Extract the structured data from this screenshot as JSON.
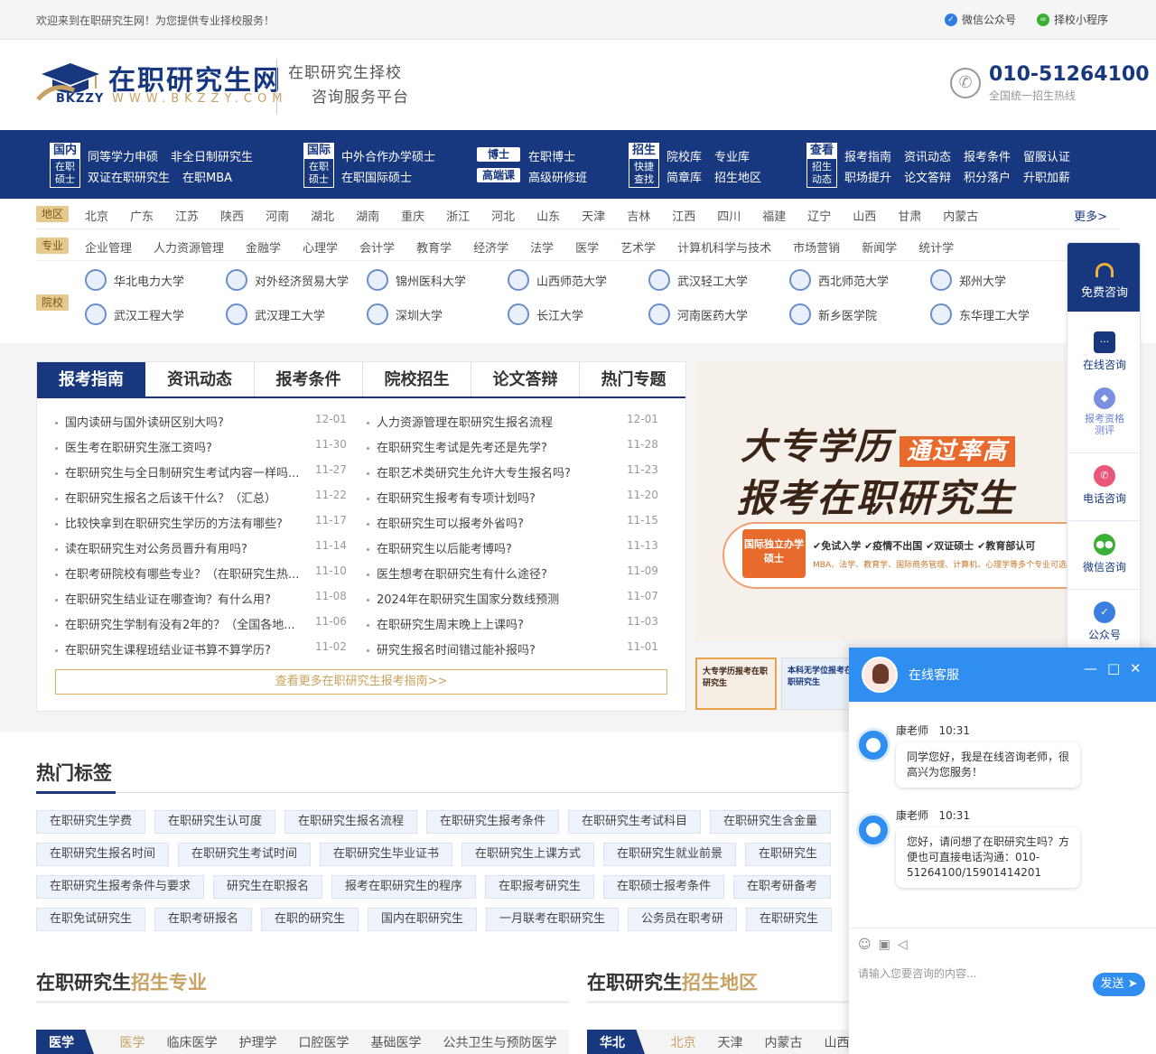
{
  "topbar": {
    "welcome": "欢迎来到在职研究生网！为您提供专业择校服务！",
    "links": [
      {
        "label": "微信公众号",
        "icon": "wechat-official-icon",
        "color": "#2f7de1"
      },
      {
        "label": "择校小程序",
        "icon": "mini-program-icon",
        "color": "#3cb034"
      }
    ]
  },
  "header": {
    "logo_text": "BKZZY",
    "site_name": "在职研究生网",
    "url": "WWW.BKZZY.COM",
    "slogan_line1": "在职研究生择校",
    "slogan_line2": "咨询服务平台",
    "hotline": "010-51264100",
    "hotline_sub": "全国统一招生热线"
  },
  "colors": {
    "primary": "#17387e",
    "gold": "#c7a264",
    "chat_blue": "#2f8ef0"
  },
  "nav": [
    {
      "box_top": "国内",
      "box_bottom": "在职硕士",
      "row1": [
        "同等学力申硕",
        "非全日制研究生"
      ],
      "row2": [
        "双证在职研究生",
        "在职MBA"
      ]
    },
    {
      "box_top": "国际",
      "box_bottom": "在职硕士",
      "row1": [
        "中外合作办学硕士"
      ],
      "row2": [
        "在职国际硕士"
      ]
    },
    {
      "pill1": "博士",
      "pill2": "高端课",
      "row1": [
        "在职博士"
      ],
      "row2": [
        "高级研修班"
      ]
    },
    {
      "box_top": "招生",
      "box_bottom": "快捷查找",
      "row1": [
        "院校库",
        "专业库"
      ],
      "row2": [
        "简章库",
        "招生地区"
      ]
    },
    {
      "box_top": "查看",
      "box_bottom": "招生动态",
      "row1": [
        "报考指南",
        "资讯动态",
        "报考条件",
        "留服认证"
      ],
      "row2": [
        "职场提升",
        "论文答辩",
        "积分落户",
        "升职加薪"
      ]
    }
  ],
  "filters": {
    "region": {
      "tag": "地区",
      "items": [
        "北京",
        "广东",
        "江苏",
        "陕西",
        "河南",
        "湖北",
        "湖南",
        "重庆",
        "浙江",
        "河北",
        "山东",
        "天津",
        "吉林",
        "江西",
        "四川",
        "福建",
        "辽宁",
        "山西",
        "甘肃",
        "内蒙古"
      ],
      "more": "更多>"
    },
    "major": {
      "tag": "专业",
      "items": [
        "企业管理",
        "人力资源管理",
        "金融学",
        "心理学",
        "会计学",
        "教育学",
        "经济学",
        "法学",
        "医学",
        "艺术学",
        "计算机科学与技术",
        "市场营销",
        "新闻学",
        "统计学"
      ]
    },
    "school_tag": "院校"
  },
  "schools": [
    "华北电力大学",
    "对外经济贸易大学",
    "锦州医科大学",
    "山西师范大学",
    "武汉轻工大学",
    "西北师范大学",
    "郑州大学",
    "武汉工程大学",
    "武汉理工大学",
    "深圳大学",
    "长江大学",
    "河南医药大学",
    "新乡医学院",
    "东华理工大学"
  ],
  "tabs": [
    "报考指南",
    "资讯动态",
    "报考条件",
    "院校招生",
    "论文答辩",
    "热门专题"
  ],
  "news_left": [
    {
      "title": "国内读研与国外读研区别大吗?",
      "date": "12-01"
    },
    {
      "title": "医生考在职研究生涨工资吗?",
      "date": "11-30"
    },
    {
      "title": "在职研究生与全日制研究生考试内容一样吗...",
      "date": "11-27"
    },
    {
      "title": "在职研究生报名之后该干什么？（汇总）",
      "date": "11-22"
    },
    {
      "title": "比较快拿到在职研究生学历的方法有哪些?",
      "date": "11-17"
    },
    {
      "title": "读在职研究生对公务员晋升有用吗?",
      "date": "11-14"
    },
    {
      "title": "在职考研院校有哪些专业？（在职研究生热...",
      "date": "11-10"
    },
    {
      "title": "在职研究生结业证在哪查询？有什么用?",
      "date": "11-08"
    },
    {
      "title": "在职研究生学制有没有2年的？（全国各地...",
      "date": "11-06"
    },
    {
      "title": "在职研究生课程班结业证书算不算学历?",
      "date": "11-02"
    }
  ],
  "news_right": [
    {
      "title": "人力资源管理在职研究生报名流程",
      "date": "12-01"
    },
    {
      "title": "在职研究生考试是先考还是先学?",
      "date": "11-28"
    },
    {
      "title": "在职艺术类研究生允许大专生报名吗?",
      "date": "11-23"
    },
    {
      "title": "在职研究生报考有专项计划吗?",
      "date": "11-20"
    },
    {
      "title": "在职研究生可以报考外省吗?",
      "date": "11-15"
    },
    {
      "title": "在职研究生以后能考博吗?",
      "date": "11-13"
    },
    {
      "title": "医生想考在职研究生有什么途径?",
      "date": "11-09"
    },
    {
      "title": "2024年在职研究生国家分数线预测",
      "date": "11-07"
    },
    {
      "title": "在职研究生周末晚上上课吗?",
      "date": "11-03"
    },
    {
      "title": "研究生报名时间错过能补报吗?",
      "date": "11-01"
    }
  ],
  "more_link": "查看更多在职研究生报考指南>>",
  "banner": {
    "line1": "大专学历",
    "highlight": "通过率高",
    "line2": "报考在职研究生",
    "badge": "国际独立办学硕士",
    "features": "✔免试入学 ✔疫情不出国 ✔双证硕士 ✔教育部认可",
    "sub": "MBA、法学、教育学、国际商务管理、计算机、心理学等多个专业可选",
    "thumb1": "大专学历报考在职研究生",
    "thumb2": "本科无学位报考在职研究生"
  },
  "hot_tags_title": "热门标签",
  "hot_tags": [
    [
      "在职研究生学费",
      "在职研究生认可度",
      "在职研究生报名流程",
      "在职研究生报考条件",
      "在职研究生考试科目",
      "在职研究生含金量"
    ],
    [
      "在职研究生报名时间",
      "在职研究生考试时间",
      "在职研究生毕业证书",
      "在职研究生上课方式",
      "在职研究生就业前景",
      "在职研究生"
    ],
    [
      "在职研究生报考条件与要求",
      "研究生在职报名",
      "报考在职研究生的程序",
      "在职报考研究生",
      "在职硕士报考条件",
      "在职考研备考"
    ],
    [
      "在职免试研究生",
      "在职考研报名",
      "在职的研究生",
      "国内在职研究生",
      "一月联考在职研究生",
      "公务员在职考研",
      "在职研究生"
    ]
  ],
  "majors_section": {
    "title_a": "在职研究生",
    "title_b": "招生专业",
    "lead": "医学",
    "items": [
      "医学",
      "临床医学",
      "护理学",
      "口腔医学",
      "基础医学",
      "公共卫生与预防医学"
    ]
  },
  "regions_section": {
    "title_a": "在职研究生",
    "title_b": "招生地区",
    "lead": "华北",
    "items": [
      "北京",
      "天津",
      "内蒙古",
      "山西"
    ]
  },
  "sidebar": {
    "top": "免费咨询",
    "items": [
      {
        "label": "在线咨询",
        "icon": "chat-icon",
        "color": "#17387e"
      },
      {
        "label": "报考资格测评",
        "icon": "assessment-icon",
        "color": "#7b8fe0"
      },
      {
        "label": "电话咨询",
        "icon": "phone-icon",
        "color": "#e9577a"
      },
      {
        "label": "微信咨询",
        "icon": "wechat-icon",
        "color": "#3cb034"
      },
      {
        "label": "公众号",
        "icon": "verified-icon",
        "color": "#3a7fe0"
      }
    ]
  },
  "chat": {
    "title": "在线客服",
    "messages": [
      {
        "sender": "康老师",
        "time": "10:31",
        "text": "同学您好，我是在线咨询老师，很高兴为您服务！"
      },
      {
        "sender": "康老师",
        "time": "10:31",
        "text": "您好，请问想了在职研究生吗？方便也可直接电话沟通：010-51264100/15901414201"
      }
    ],
    "placeholder": "请输入您要咨询的内容...",
    "send": "发送"
  }
}
